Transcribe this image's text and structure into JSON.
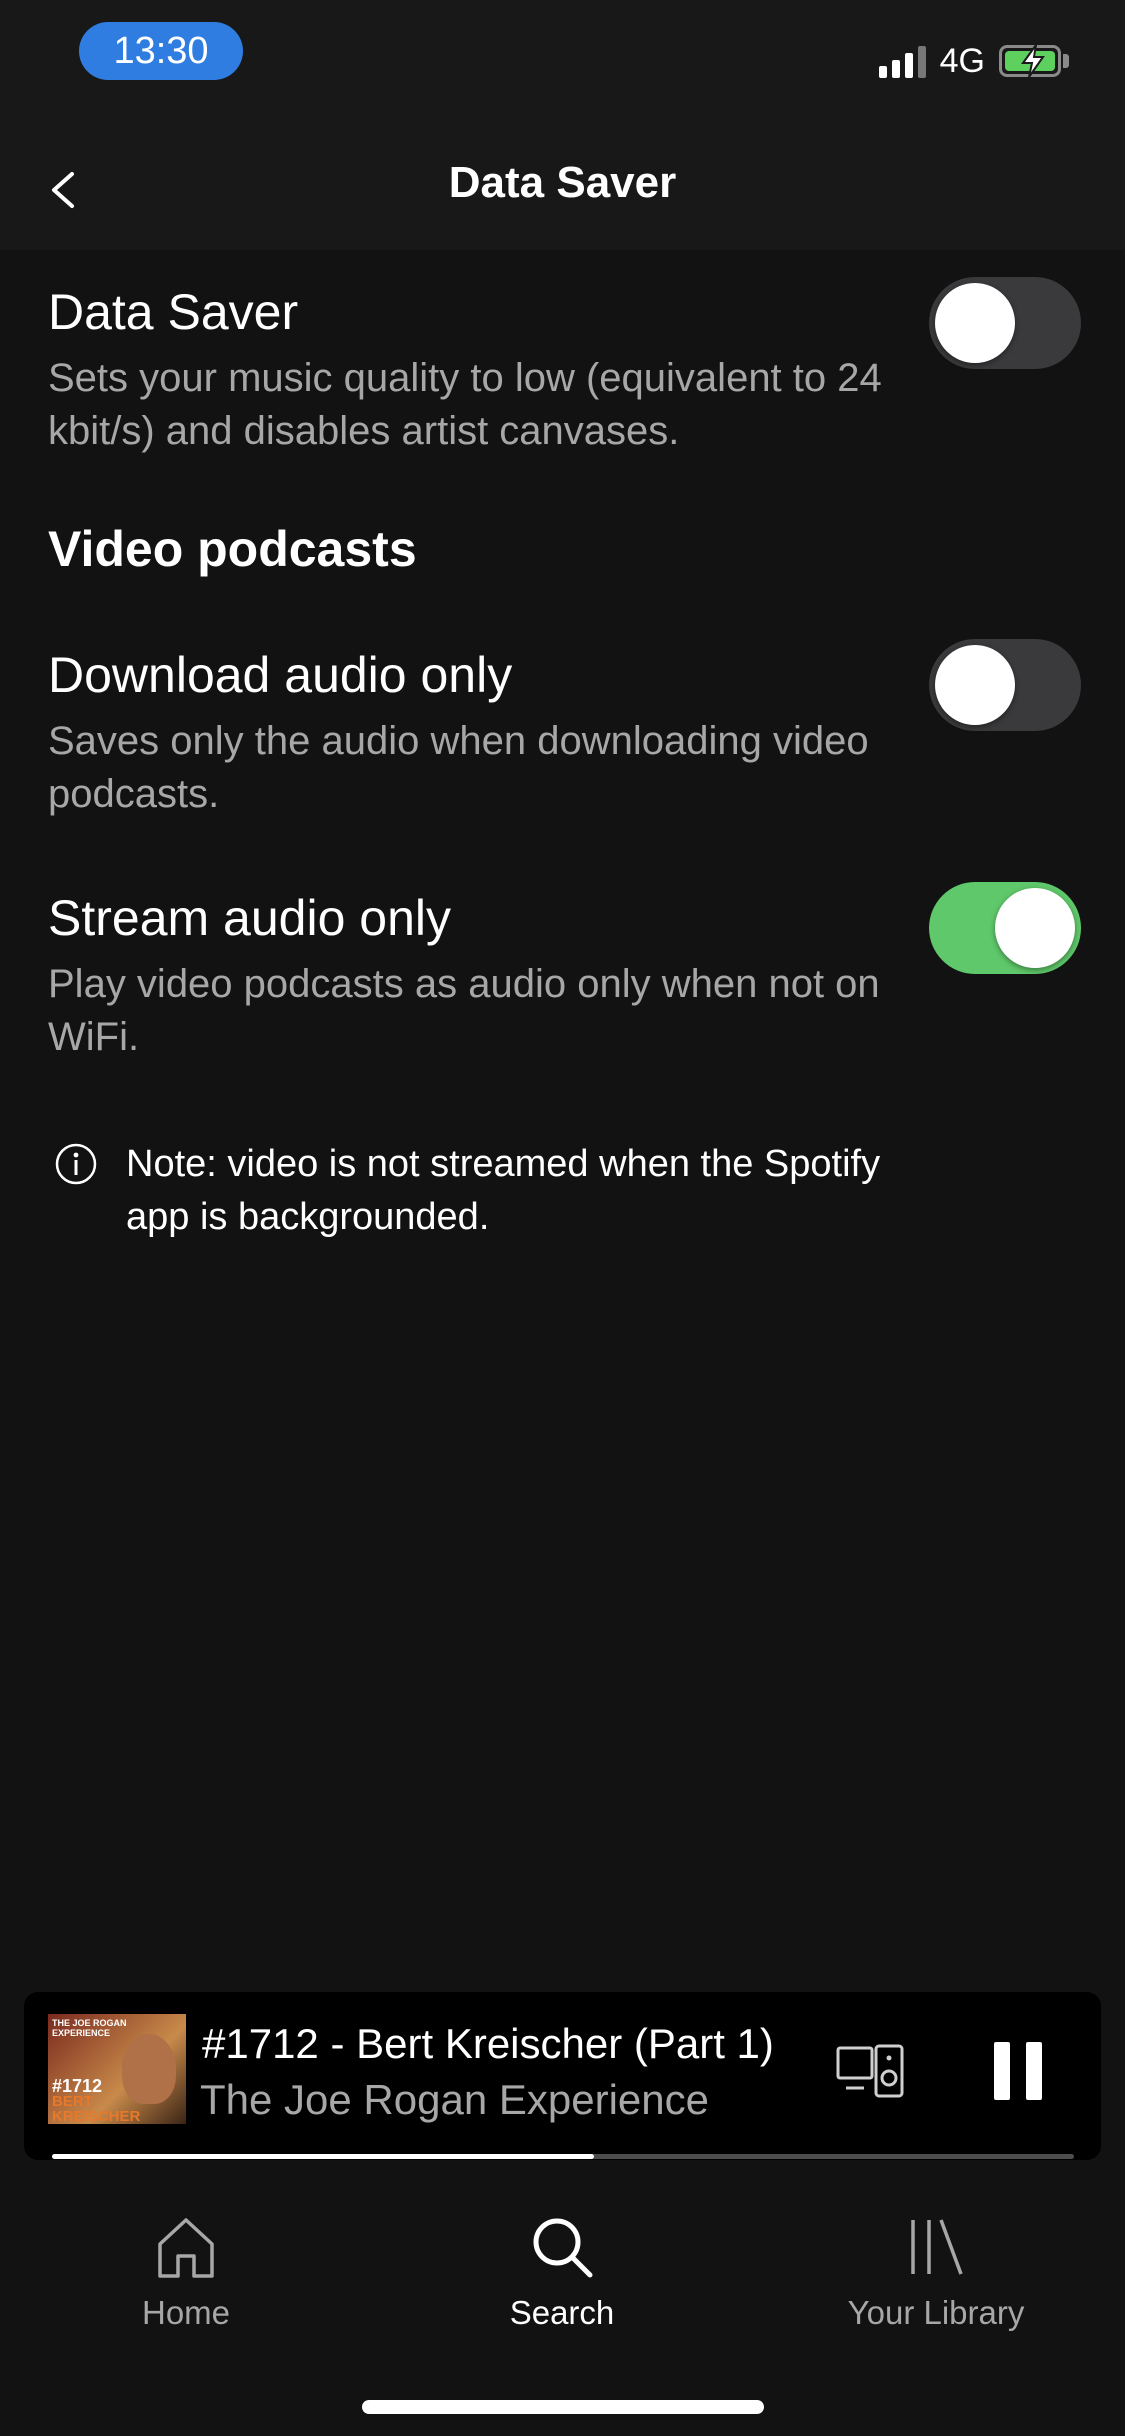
{
  "status_bar": {
    "time": "13:30",
    "network": "4G"
  },
  "header": {
    "title": "Data Saver"
  },
  "data_saver": {
    "title": "Data Saver",
    "description": "Sets your music quality to low (equivalent to 24 kbit/s) and disables artist canvases.",
    "enabled": false
  },
  "video_podcasts": {
    "heading": "Video podcasts",
    "download_audio_only": {
      "title": "Download audio only",
      "description": "Saves only the audio when downloading video podcasts.",
      "enabled": false
    },
    "stream_audio_only": {
      "title": "Stream audio only",
      "description": "Play video podcasts as audio only when not on WiFi.",
      "enabled": true
    }
  },
  "note": {
    "text": "Note: video is not streamed when the Spotify app is backgrounded."
  },
  "now_playing": {
    "artwork_text": {
      "show": "THE JOE ROGAN EXPERIENCE",
      "episode": "#1712",
      "guest": "BERT KREISCHER"
    },
    "title": "#1712 - Bert Kreischer (Part 1)",
    "subtitle": "The Joe Rogan Experience",
    "progress": 0.53
  },
  "tabs": [
    {
      "label": "Home",
      "icon": "home-icon",
      "active": false
    },
    {
      "label": "Search",
      "icon": "search-icon",
      "active": true
    },
    {
      "label": "Your Library",
      "icon": "library-icon",
      "active": false
    }
  ],
  "colors": {
    "background": "#121212",
    "accent_green": "#5fc86a",
    "time_pill": "#2f7de1"
  }
}
